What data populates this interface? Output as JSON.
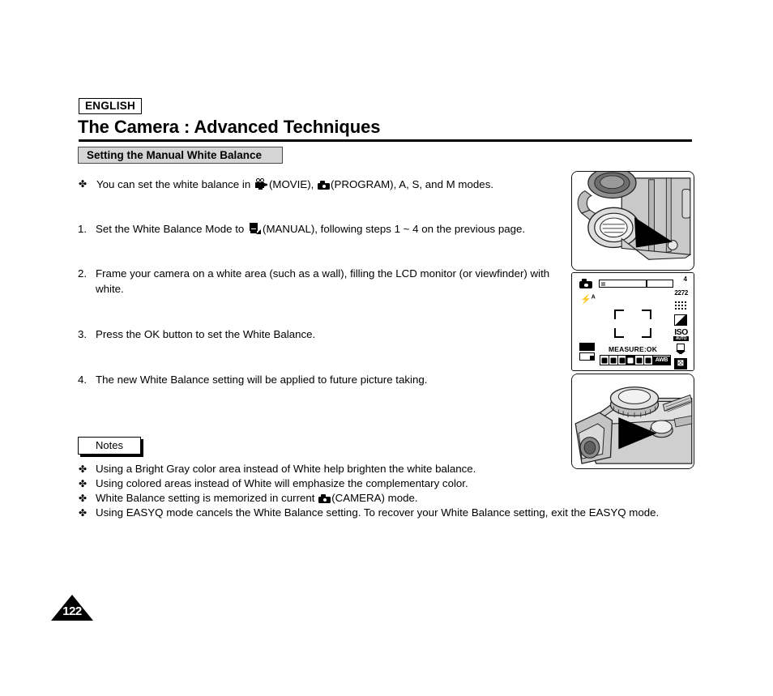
{
  "header": {
    "language_badge": "ENGLISH",
    "title": "The Camera : Advanced Techniques",
    "section": "Setting the Manual White Balance"
  },
  "body": {
    "intro": {
      "marker": "✤",
      "text_before_movie": "You can set the white balance in",
      "movie_label": "(MOVIE),",
      "program_label": "(PROGRAM), A, S, and M modes."
    },
    "steps": [
      {
        "marker": "1.",
        "text_before_icon": "Set the White Balance Mode to",
        "text_after_icon": "(MANUAL), following steps 1 ~ 4 on the previous page."
      },
      {
        "marker": "2.",
        "text": "Frame your camera on a white area (such as a wall), filling the LCD monitor (or viewfinder) with white."
      },
      {
        "marker": "3.",
        "text": "Press the OK button to set the White Balance."
      },
      {
        "marker": "4.",
        "text": "The new White Balance setting will be applied to future picture taking."
      }
    ]
  },
  "notes": {
    "label": "Notes",
    "items": [
      {
        "marker": "✤",
        "text": "Using a Bright Gray color area instead of White help brighten the white balance."
      },
      {
        "marker": "✤",
        "text": "Using colored areas instead of White will emphasize the complementary color."
      },
      {
        "marker": "✤",
        "text_before_icon": "White Balance setting is memorized in current",
        "text_after_icon": "(CAMERA) mode."
      },
      {
        "marker": "✤",
        "text": "Using EASYQ mode cancels the White Balance setting. To recover your White Balance setting, exit the EASYQ mode."
      }
    ]
  },
  "lcd": {
    "frame_count": "4",
    "resolution": "2272",
    "flash_mode": "A",
    "measure_text": "MEASURE:OK",
    "awb_label": "AWB",
    "iso_text": "ISO",
    "iso_sub": "AUTO",
    "ev_label": "⊠"
  },
  "page_number": "122"
}
